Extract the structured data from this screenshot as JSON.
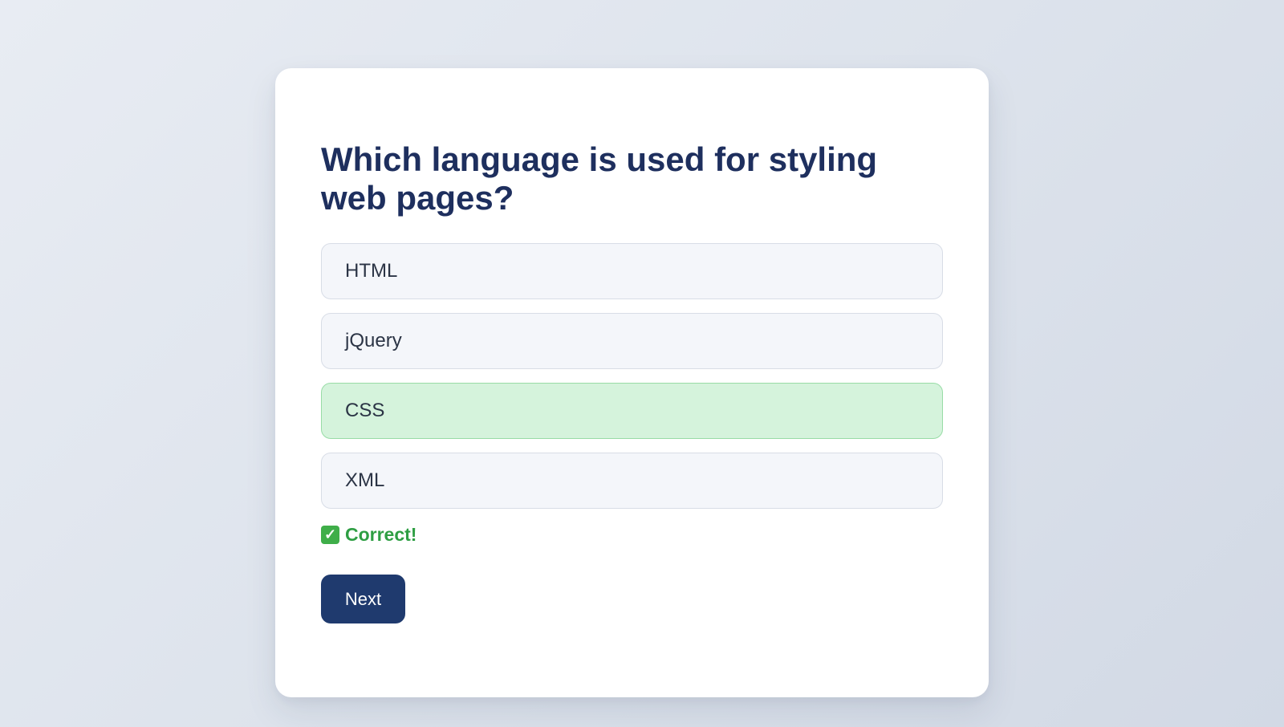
{
  "quiz": {
    "question": "Which language is used for styling web pages?",
    "options": [
      {
        "label": "HTML",
        "state": "default"
      },
      {
        "label": "jQuery",
        "state": "default"
      },
      {
        "label": "CSS",
        "state": "correct"
      },
      {
        "label": "XML",
        "state": "default"
      }
    ],
    "feedback": {
      "icon": "check-mark-icon",
      "icon_glyph": "✓",
      "text": "Correct!"
    },
    "next_label": "Next"
  },
  "colors": {
    "title": "#1e2f5e",
    "correct_bg": "#d5f3dc",
    "correct_border": "#98dca6",
    "feedback_text": "#2e9e43",
    "button_bg": "#1f3a6e"
  }
}
